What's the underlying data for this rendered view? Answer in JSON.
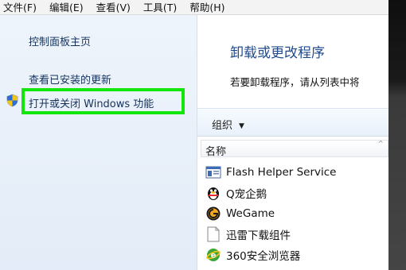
{
  "menu": [
    "文件(F)",
    "编辑(E)",
    "查看(V)",
    "工具(T)",
    "帮助(H)"
  ],
  "left_pane": {
    "home_link": "控制面板主页",
    "updates_link": "查看已安装的更新",
    "features_link": "打开或关闭 Windows 功能"
  },
  "main": {
    "title": "卸载或更改程序",
    "description": "若要卸载程序，请从列表中将",
    "organize_label": "组织",
    "column_name": "名称"
  },
  "programs": [
    {
      "name": "Flash Helper Service",
      "icon": "flash-helper-icon"
    },
    {
      "name": "Q宠企鹅",
      "icon": "qq-penguin-icon"
    },
    {
      "name": "WeGame",
      "icon": "wegame-icon"
    },
    {
      "name": "迅雷下载组件",
      "icon": "document-icon"
    },
    {
      "name": "360安全浏览器",
      "icon": "360-browser-icon"
    }
  ],
  "colors": {
    "highlight": "#13e60a",
    "link": "#15325d",
    "title": "#1f4a8f"
  }
}
